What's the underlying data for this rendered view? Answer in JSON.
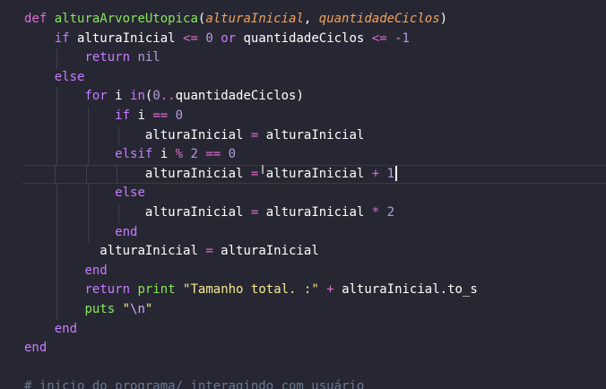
{
  "editor": {
    "lines": [
      {
        "indent": 0,
        "tokens": [
          {
            "t": "def",
            "c": "def"
          },
          {
            "t": " ",
            "c": "var"
          },
          {
            "t": "alturaArvoreUtopica",
            "c": "fn"
          },
          {
            "t": "(",
            "c": "var"
          },
          {
            "t": "alturaInicial",
            "c": "param"
          },
          {
            "t": ", ",
            "c": "var"
          },
          {
            "t": "quantidadeCiclos",
            "c": "param"
          },
          {
            "t": ")",
            "c": "var"
          }
        ]
      },
      {
        "indent": 1,
        "tokens": [
          {
            "t": "if",
            "c": "kw"
          },
          {
            "t": " alturaInicial ",
            "c": "var"
          },
          {
            "t": "<=",
            "c": "op"
          },
          {
            "t": " ",
            "c": "var"
          },
          {
            "t": "0",
            "c": "num"
          },
          {
            "t": " ",
            "c": "var"
          },
          {
            "t": "or",
            "c": "kw"
          },
          {
            "t": " quantidadeCiclos ",
            "c": "var"
          },
          {
            "t": "<=",
            "c": "op"
          },
          {
            "t": " ",
            "c": "var"
          },
          {
            "t": "-1",
            "c": "num"
          }
        ]
      },
      {
        "indent": 2,
        "tokens": [
          {
            "t": "return",
            "c": "kw"
          },
          {
            "t": " ",
            "c": "var"
          },
          {
            "t": "nil",
            "c": "nil"
          }
        ]
      },
      {
        "indent": 1,
        "tokens": [
          {
            "t": "else",
            "c": "kw"
          }
        ]
      },
      {
        "indent": 2,
        "tokens": [
          {
            "t": "for",
            "c": "kw"
          },
          {
            "t": " i ",
            "c": "var"
          },
          {
            "t": "in",
            "c": "kw"
          },
          {
            "t": "(",
            "c": "var"
          },
          {
            "t": "0",
            "c": "num"
          },
          {
            "t": "..",
            "c": "op"
          },
          {
            "t": "quantidadeCiclos)",
            "c": "var"
          }
        ]
      },
      {
        "indent": 3,
        "tokens": [
          {
            "t": "if",
            "c": "kw"
          },
          {
            "t": " i ",
            "c": "var"
          },
          {
            "t": "==",
            "c": "op"
          },
          {
            "t": " ",
            "c": "var"
          },
          {
            "t": "0",
            "c": "num"
          }
        ]
      },
      {
        "indent": 4,
        "tokens": [
          {
            "t": "alturaInicial ",
            "c": "var"
          },
          {
            "t": "=",
            "c": "op"
          },
          {
            "t": " alturaInicial",
            "c": "var"
          }
        ]
      },
      {
        "indent": 3,
        "tokens": [
          {
            "t": "elsif",
            "c": "kw"
          },
          {
            "t": " i ",
            "c": "var"
          },
          {
            "t": "%",
            "c": "op"
          },
          {
            "t": " ",
            "c": "var"
          },
          {
            "t": "2",
            "c": "num"
          },
          {
            "t": " ",
            "c": "var"
          },
          {
            "t": "==",
            "c": "op"
          },
          {
            "t": " ",
            "c": "var"
          },
          {
            "t": "0",
            "c": "num"
          }
        ]
      },
      {
        "indent": 4,
        "current": true,
        "cursor": true,
        "tokens": [
          {
            "t": "alturaInicial ",
            "c": "var"
          },
          {
            "t": "=",
            "c": "op"
          },
          {
            "t": " alturaInicial ",
            "c": "var"
          },
          {
            "t": "+",
            "c": "op"
          },
          {
            "t": " ",
            "c": "var"
          },
          {
            "t": "1",
            "c": "num"
          }
        ]
      },
      {
        "indent": 3,
        "tokens": [
          {
            "t": "else",
            "c": "kw"
          }
        ]
      },
      {
        "indent": 4,
        "tokens": [
          {
            "t": "alturaInicial ",
            "c": "var"
          },
          {
            "t": "=",
            "c": "op"
          },
          {
            "t": " alturaInicial ",
            "c": "var"
          },
          {
            "t": "*",
            "c": "op"
          },
          {
            "t": " ",
            "c": "var"
          },
          {
            "t": "2",
            "c": "num"
          }
        ]
      },
      {
        "indent": 3,
        "tokens": [
          {
            "t": "end",
            "c": "kw"
          }
        ]
      },
      {
        "indent": 2,
        "pad": "  ",
        "tokens": [
          {
            "t": "alturaInicial ",
            "c": "var"
          },
          {
            "t": "=",
            "c": "op"
          },
          {
            "t": " alturaInicial",
            "c": "var"
          }
        ]
      },
      {
        "indent": 2,
        "tokens": [
          {
            "t": "end",
            "c": "kw"
          }
        ]
      },
      {
        "indent": 2,
        "tokens": [
          {
            "t": "return",
            "c": "kw"
          },
          {
            "t": " ",
            "c": "var"
          },
          {
            "t": "print",
            "c": "fn"
          },
          {
            "t": " ",
            "c": "var"
          },
          {
            "t": "\"Tamanho total. :\"",
            "c": "str"
          },
          {
            "t": " ",
            "c": "var"
          },
          {
            "t": "+",
            "c": "op"
          },
          {
            "t": " alturaInicial.to_s",
            "c": "var"
          }
        ]
      },
      {
        "indent": 2,
        "tokens": [
          {
            "t": "puts",
            "c": "fn"
          },
          {
            "t": " ",
            "c": "var"
          },
          {
            "t": "\"",
            "c": "str"
          },
          {
            "t": "\\n",
            "c": "esc"
          },
          {
            "t": "\"",
            "c": "str"
          }
        ]
      },
      {
        "indent": 1,
        "tokens": [
          {
            "t": "end",
            "c": "kw"
          }
        ]
      },
      {
        "indent": 0,
        "tokens": [
          {
            "t": "end",
            "c": "kw"
          }
        ]
      },
      {
        "indent": 0,
        "tokens": []
      },
      {
        "indent": 0,
        "tokens": [
          {
            "t": "# inicio do programa/ interagindo com usuário",
            "c": "cm"
          }
        ]
      }
    ]
  },
  "ibeam_icon": "I"
}
